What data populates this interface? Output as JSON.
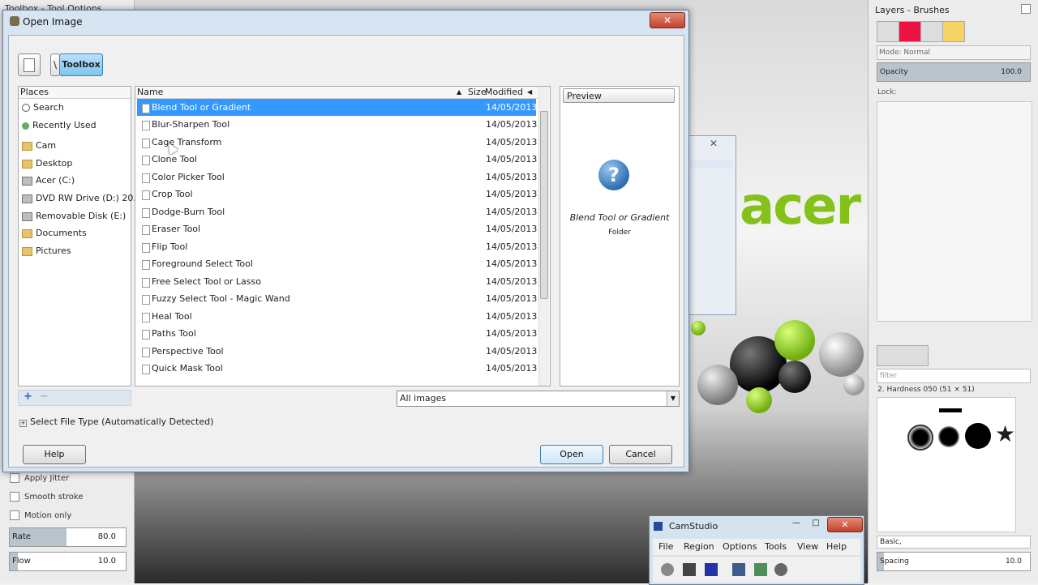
{
  "toolbox": {
    "title": "Toolbox - Tool Options",
    "apply_jitter": "Apply Jitter",
    "smooth_stroke": "Smooth stroke",
    "motion_only": "Motion only",
    "rate_label": "Rate",
    "rate_value": "80.0",
    "flow_label": "Flow",
    "flow_value": "10.0"
  },
  "dock": {
    "title": "Layers - Brushes",
    "mode_label": "Mode: Normal",
    "opacity_label": "Opacity",
    "opacity_value": "100.0",
    "lock_label": "Lock:",
    "filter_placeholder": "filter",
    "brush_name": "2. Hardness 050 (51 × 51)",
    "preset": "Basic,",
    "spacing_label": "Spacing",
    "spacing_value": "10.0"
  },
  "dialog": {
    "title": "Open Image",
    "close": "✕",
    "path_separator": "\\",
    "current_folder": "Toolbox",
    "places_header": "Places",
    "places": [
      "Search",
      "Recently Used",
      "Cam",
      "Desktop",
      "Acer (C:)",
      "DVD RW Drive (D:) 20...",
      "Removable Disk (E:)",
      "Documents",
      "Pictures"
    ],
    "columns": {
      "name": "Name",
      "size": "Size",
      "modified": "Modified"
    },
    "files": [
      {
        "name": "Blend Tool or Gradient",
        "date": "14/05/2013"
      },
      {
        "name": "Blur-Sharpen Tool",
        "date": "14/05/2013"
      },
      {
        "name": "Cage Transform",
        "date": "14/05/2013"
      },
      {
        "name": "Clone Tool",
        "date": "14/05/2013"
      },
      {
        "name": "Color Picker Tool",
        "date": "14/05/2013"
      },
      {
        "name": "Crop Tool",
        "date": "14/05/2013"
      },
      {
        "name": "Dodge-Burn Tool",
        "date": "14/05/2013"
      },
      {
        "name": "Eraser Tool",
        "date": "14/05/2013"
      },
      {
        "name": "Flip Tool",
        "date": "14/05/2013"
      },
      {
        "name": "Foreground Select Tool",
        "date": "14/05/2013"
      },
      {
        "name": "Free Select Tool or Lasso",
        "date": "14/05/2013"
      },
      {
        "name": "Fuzzy Select Tool - Magic Wand",
        "date": "14/05/2013"
      },
      {
        "name": "Heal Tool",
        "date": "14/05/2013"
      },
      {
        "name": "Paths Tool",
        "date": "14/05/2013"
      },
      {
        "name": "Perspective Tool",
        "date": "14/05/2013"
      },
      {
        "name": "Quick Mask Tool",
        "date": "14/05/2013"
      }
    ],
    "preview_label": "Preview",
    "preview_name": "Blend Tool or Gradient",
    "preview_type": "Folder",
    "filter_value": "All images",
    "file_type": "Select File Type (Automatically Detected)",
    "help": "Help",
    "open": "Open",
    "cancel": "Cancel"
  },
  "camstudio": {
    "title": "CamStudio",
    "menu": [
      "File",
      "Region",
      "Options",
      "Tools",
      "View",
      "Help"
    ]
  }
}
